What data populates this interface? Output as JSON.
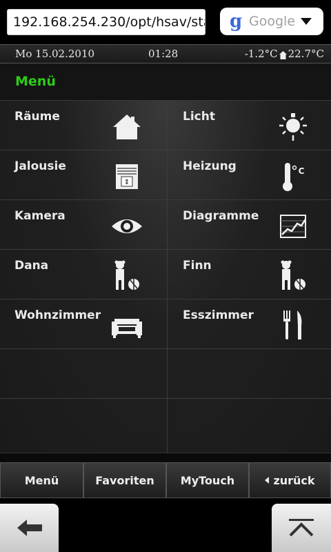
{
  "browser": {
    "url": "192.168.254.230/opt/hsav/sta",
    "search_engine_label": "Google"
  },
  "status": {
    "date": "Mo 15.02.2010",
    "time": "01:28",
    "outside_temp": "-1.2°C",
    "inside_temp": "22.7°C"
  },
  "header": {
    "title": "Menü",
    "title_color": "#2ecc1a"
  },
  "grid": {
    "rows": [
      [
        {
          "label": "Räume",
          "icon": "house-icon"
        },
        {
          "label": "Licht",
          "icon": "light-bulb-icon"
        }
      ],
      [
        {
          "label": "Jalousie",
          "icon": "blinds-icon"
        },
        {
          "label": "Heizung",
          "icon": "thermometer-icon"
        }
      ],
      [
        {
          "label": "Kamera",
          "icon": "eye-icon"
        },
        {
          "label": "Diagramme",
          "icon": "chart-icon"
        }
      ],
      [
        {
          "label": "Dana",
          "icon": "child-toy-icon"
        },
        {
          "label": "Finn",
          "icon": "child-toy-icon"
        }
      ],
      [
        {
          "label": "Wohnzimmer",
          "icon": "sofa-icon"
        },
        {
          "label": "Esszimmer",
          "icon": "fork-knife-icon"
        }
      ],
      [
        {
          "label": "",
          "icon": ""
        },
        {
          "label": "",
          "icon": ""
        }
      ],
      [
        {
          "label": "",
          "icon": ""
        },
        {
          "label": "",
          "icon": ""
        }
      ]
    ]
  },
  "nav": {
    "menu": "Menü",
    "favorites": "Favoriten",
    "mytouch": "MyTouch",
    "back": "zurück"
  }
}
